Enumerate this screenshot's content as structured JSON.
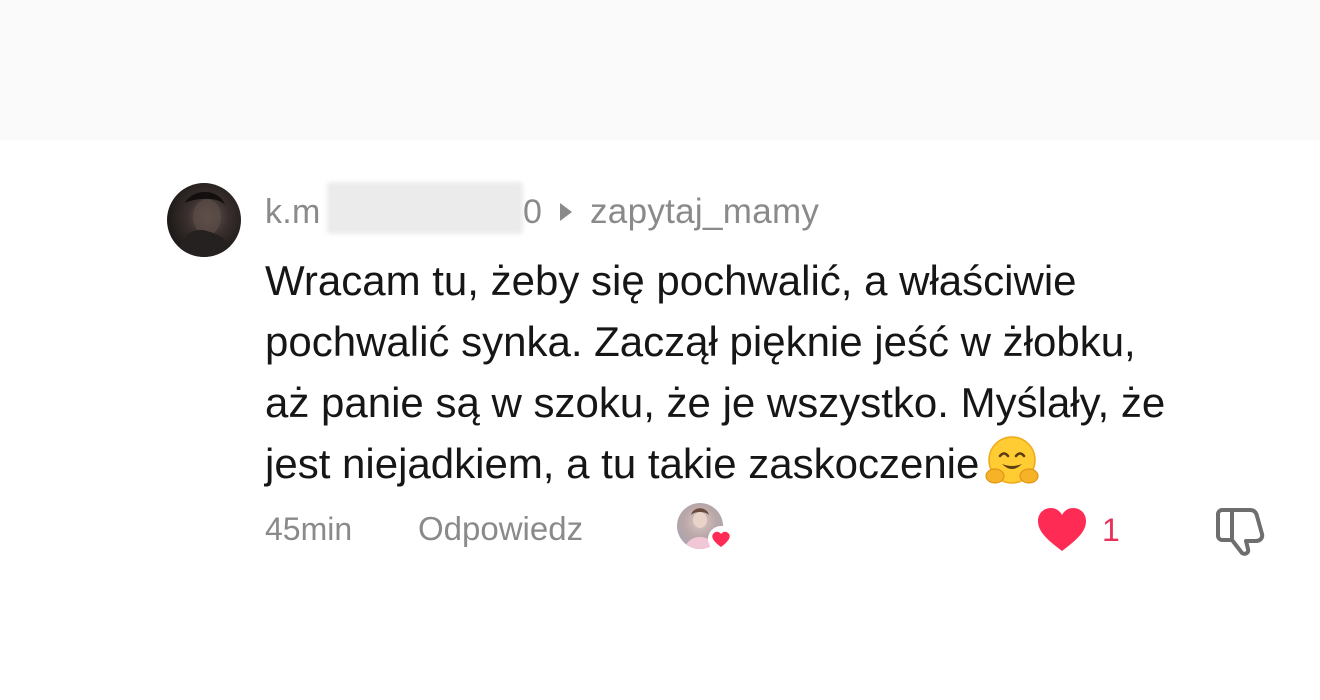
{
  "comment": {
    "username_visible_prefix": "k.m",
    "username_visible_suffix": "0",
    "reply_to": "zapytaj_mamy",
    "text_lines": [
      "Wracam tu, żeby się pochwalić, a właściwie",
      "pochwalić synka. Zaczął pięknie jeść w żłobku,",
      "aż panie są w szoku, że je wszystko. Myślały, że",
      "jest niejadkiem, a tu takie zaskoczenie"
    ],
    "emoji": "hugging-face-emoji",
    "time": "45min",
    "reply_label": "Odpowiedz",
    "like_count": "1",
    "icons": {
      "reply_arrow": "caret-right-icon",
      "like": "heart-icon",
      "dislike": "thumbs-down-icon",
      "creator_like": "creator-liked-heart-icon"
    },
    "colors": {
      "like": "#fe2c55",
      "muted_text": "#8a8a8a",
      "text": "#161616"
    }
  }
}
